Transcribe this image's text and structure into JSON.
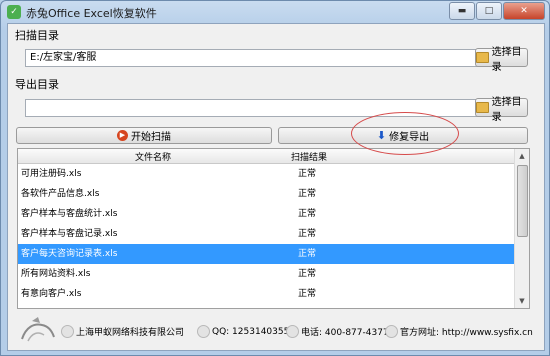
{
  "window": {
    "app_icon_glyph": "✓",
    "title": "赤兔Office Excel恢复软件",
    "minimize_glyph": "▬",
    "maximize_glyph": "□",
    "close_glyph": "✕"
  },
  "scan": {
    "label": "扫描目录",
    "path_value": "E:/左家宝/客服",
    "choose_label": "选择目录"
  },
  "export": {
    "label": "导出目录",
    "path_value": "",
    "choose_label": "选择目录"
  },
  "actions": {
    "start_label": "开始扫描",
    "start_glyph": "▶",
    "repair_label": "修复导出",
    "repair_glyph": "⬇"
  },
  "table": {
    "columns": [
      "文件名称",
      "扫描结果"
    ],
    "rows": [
      {
        "name": "可用注册码.xls",
        "status": "正常"
      },
      {
        "name": "各软件产品信息.xls",
        "status": "正常"
      },
      {
        "name": "客户样本与客盘统计.xls",
        "status": "正常"
      },
      {
        "name": "客户样本与客盘记录.xls",
        "status": "正常"
      },
      {
        "name": "客户每天咨询记录表.xls",
        "status": "正常"
      },
      {
        "name": "所有网站资料.xls",
        "status": "正常"
      },
      {
        "name": "有意向客户.xls",
        "status": "正常"
      }
    ],
    "selected_index": 4,
    "scroll_up_glyph": "▲",
    "scroll_down_glyph": "▼"
  },
  "footer": {
    "company": "上海甲蚁网络科技有限公司",
    "qq": "QQ: 1253140355",
    "phone": "电话: 400-877-4377",
    "website": "官方网址: http://www.sysfix.cn"
  },
  "colors": {
    "selection": "#3399ff",
    "annotation_circle": "#d64b4b"
  }
}
